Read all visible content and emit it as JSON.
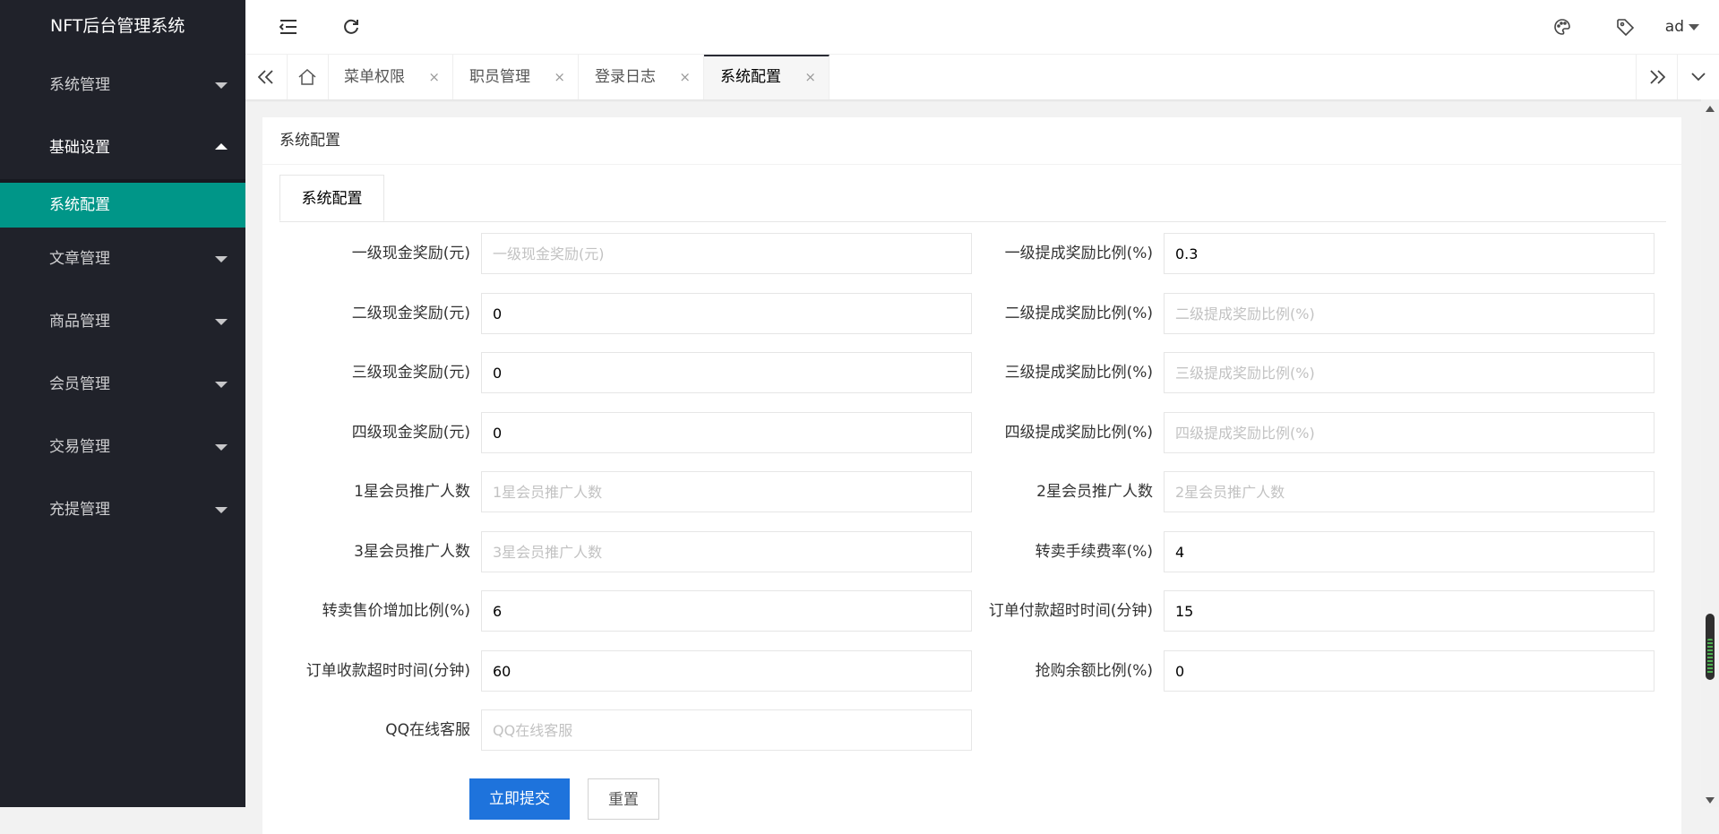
{
  "app": {
    "title": "NFT后台管理系统"
  },
  "sidebar": {
    "items": [
      {
        "label": "系统管理"
      },
      {
        "label": "基础设置",
        "children": [
          {
            "label": "系统配置"
          }
        ]
      },
      {
        "label": "文章管理"
      },
      {
        "label": "商品管理"
      },
      {
        "label": "会员管理"
      },
      {
        "label": "交易管理"
      },
      {
        "label": "充提管理"
      }
    ]
  },
  "header": {
    "icons": [
      "menu-collapse-icon",
      "refresh-icon",
      "palette-icon",
      "tag-icon"
    ],
    "user": "ad"
  },
  "tabs": {
    "items": [
      {
        "label": "菜单权限"
      },
      {
        "label": "职员管理"
      },
      {
        "label": "登录日志"
      },
      {
        "label": "系统配置",
        "active": true
      }
    ],
    "close_glyph": "×"
  },
  "main": {
    "card_title": "系统配置",
    "inner_tab": "系统配置",
    "fields": [
      {
        "label": "一级现金奖励(元)",
        "value": "",
        "placeholder": "一级现金奖励(元)"
      },
      {
        "label": "一级提成奖励比例(%)",
        "value": "0.3",
        "placeholder": "一级提成奖励比例(%)"
      },
      {
        "label": "二级现金奖励(元)",
        "value": "0",
        "placeholder": "二级现金奖励(元)"
      },
      {
        "label": "二级提成奖励比例(%)",
        "value": "",
        "placeholder": "二级提成奖励比例(%)"
      },
      {
        "label": "三级现金奖励(元)",
        "value": "0",
        "placeholder": "三级现金奖励(元)"
      },
      {
        "label": "三级提成奖励比例(%)",
        "value": "",
        "placeholder": "三级提成奖励比例(%)"
      },
      {
        "label": "四级现金奖励(元)",
        "value": "0",
        "placeholder": "四级现金奖励(元)"
      },
      {
        "label": "四级提成奖励比例(%)",
        "value": "",
        "placeholder": "四级提成奖励比例(%)"
      },
      {
        "label": "1星会员推广人数",
        "value": "",
        "placeholder": "1星会员推广人数"
      },
      {
        "label": "2星会员推广人数",
        "value": "",
        "placeholder": "2星会员推广人数"
      },
      {
        "label": "3星会员推广人数",
        "value": "",
        "placeholder": "3星会员推广人数"
      },
      {
        "label": "转卖手续费率(%)",
        "value": "4",
        "placeholder": "转卖手续费率(%)"
      },
      {
        "label": "转卖售价增加比例(%)",
        "value": "6",
        "placeholder": "转卖售价增加比例(%)"
      },
      {
        "label": "订单付款超时时间(分钟)",
        "value": "15",
        "placeholder": "订单付款超时时间(分钟)"
      },
      {
        "label": "订单收款超时时间(分钟)",
        "value": "60",
        "placeholder": "订单收款超时时间(分钟)"
      },
      {
        "label": "抢购余额比例(%)",
        "value": "0",
        "placeholder": "抢购余额比例(%)"
      },
      {
        "label": "QQ在线客服",
        "value": "",
        "placeholder": "QQ在线客服"
      }
    ],
    "submit_label": "立即提交",
    "reset_label": "重置"
  },
  "colors": {
    "sidebar_bg": "#20222a",
    "active_item": "#009688",
    "primary_button": "#1e73dc"
  }
}
